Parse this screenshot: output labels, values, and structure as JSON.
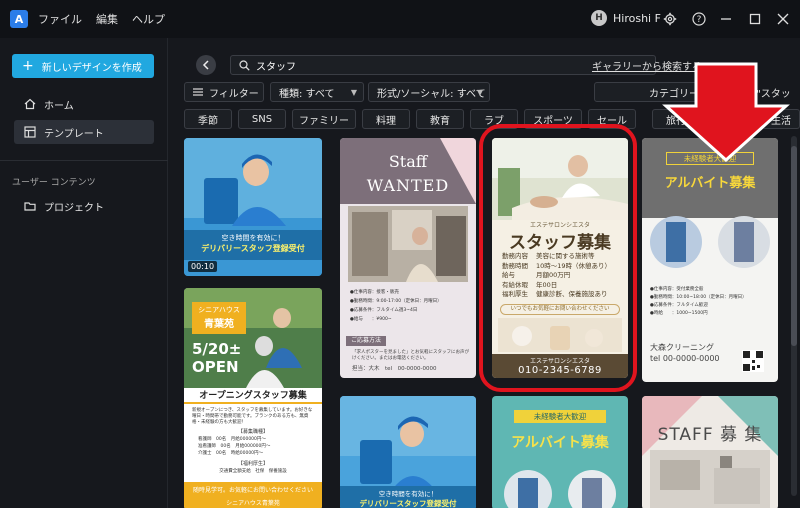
{
  "menu": {
    "file": "ファイル",
    "edit": "編集",
    "help": "ヘルプ"
  },
  "user": {
    "initial": "H",
    "name": "Hiroshi F"
  },
  "sidebar": {
    "new_design": "新しいデザインを作成",
    "home": "ホーム",
    "templates": "テンプレート",
    "user_content": "ユーザー コンテンツ",
    "projects": "プロジェクト"
  },
  "search": {
    "query": "スタッフ",
    "web_link": "ギャラリーから検索する)"
  },
  "filters": {
    "filter": "フィルター",
    "type": "種類: すべて",
    "format": "形式/ソーシャル: すべて",
    "category": "カテゴリー",
    "breadcrumb": "\"スタッフ\""
  },
  "chips": [
    "季節",
    "SNS",
    "ファミリー",
    "料理",
    "教育",
    "ラブ",
    "スポーツ",
    "セール",
    "旅行",
    "美容",
    "生活"
  ],
  "cards": {
    "delivery": {
      "line1": "空き時間を有効に！",
      "line2": "デリバリースタッフ登録受付",
      "duration": "00:10"
    },
    "staff_wanted": {
      "title1": "Staff",
      "title2": "WANTED",
      "items": [
        "●仕事内容：接客・販売",
        "●勤務時間：9:00-17:00（定休日：月曜日）",
        "●応募条件：フルタイム週3~4日",
        "●給与　　：¥900~"
      ],
      "footer_head": "ご応募方法",
      "footer_text": "「求人ポスターを見ました」とお気軽にスタッフにお声がけください。またはお電話ください。",
      "footer_contact": "担当：大木　tel　00-0000-0000"
    },
    "esthe": {
      "salon_label": "エステサロンシエスタ",
      "title": "スタッフ募集",
      "rows": [
        {
          "k": "勤務内容",
          "v": "美容に関する施術等"
        },
        {
          "k": "勤務時間",
          "v": "10時～19時（休憩あり）"
        },
        {
          "k": "給与",
          "v": "月額00万円"
        },
        {
          "k": "有給休暇",
          "v": "年00日"
        },
        {
          "k": "福利厚生",
          "v": "健康診断、保養施設あり"
        }
      ],
      "note": "いつでもお気軽にお問い合わせください",
      "name": "エステサロンシエスタ",
      "tel": "010-2345-6789"
    },
    "cleaning": {
      "badge": "未経験者大歓迎",
      "title": "アルバイト募集",
      "details": [
        "●仕事内容：受付業務全般",
        "●勤務時間：10:00~18:00（定休日：月曜日）",
        "●応募条件：フルタイム歓迎",
        "●時給　　：1000~1500円"
      ],
      "name": "大森クリーニング",
      "tel": "tel 00-0000-0000"
    },
    "senior": {
      "name1": "シニアハウス",
      "name2": "青葉苑",
      "date": "5/20±",
      "open": "OPEN",
      "banner": "オープニングスタッフ募集",
      "body": "新規オープンにつき、スタッフを募集しています。お好きな曜日・時間帯で勤務可能です。ブランクのある方も、無資格・未経験の方も大歓迎！",
      "sec1": "【募集職種】",
      "rows": [
        "看護師　00名　月給000000円～",
        "准看護師　00名　月給000000円～",
        "介護士　00名　時給00000円～"
      ],
      "sec2": "【福利厚生】",
      "benefits": "交通費全額支給　社保　保養施設",
      "bottom": "随時見学可。お気軽にお問い合わせください",
      "footer": "シニアハウス青葉苑"
    },
    "delivery2": {
      "line1": "空き時間を有効に！",
      "line2": "デリバリースタッフ登録受付"
    },
    "part_time2": {
      "badge": "未経験者大歓迎",
      "title": "アルバイト募集"
    },
    "staff_boshu": {
      "title": "STAFF 募 集"
    }
  }
}
